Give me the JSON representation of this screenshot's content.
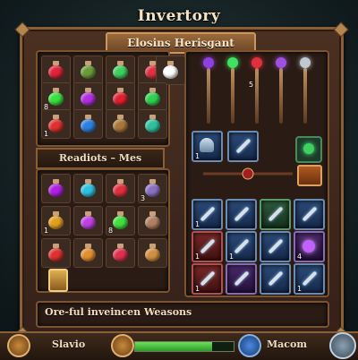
{
  "window_title": "Invertory",
  "banner_title": "Elosins Herisgant",
  "left_section_title": "Readiots – Mes storving",
  "footer_text": "Ore-ful inveincen Weasons",
  "bottom_bar": {
    "left_label": "Slavio",
    "right_label": "Macom",
    "progress": 0.78
  },
  "colors": {
    "accent": "#8a5e36",
    "panel": "#2a1c14",
    "text": "#f0dcc0"
  },
  "potions_top": [
    {
      "color": "#e0233a",
      "qty": ""
    },
    {
      "color": "#6b9a3a",
      "qty": ""
    },
    {
      "color": "#3ed060",
      "qty": ""
    },
    {
      "color": "#e03040",
      "qty": ""
    },
    {
      "color": "#ffffff",
      "qty": ""
    },
    {
      "color": "#39e040",
      "qty": "8"
    },
    {
      "color": "#b030e0",
      "qty": ""
    },
    {
      "color": "#e02030",
      "qty": ""
    },
    {
      "color": "#30d050",
      "qty": ""
    },
    {
      "color": "#e03030",
      "qty": "1"
    },
    {
      "color": "#2e80e0",
      "qty": ""
    },
    {
      "color": "#a8783a",
      "qty": ""
    },
    {
      "color": "#30c0a0",
      "qty": ""
    }
  ],
  "potions_mid": [
    {
      "color": "#b020e0",
      "qty": ""
    },
    {
      "color": "#30c0e0",
      "qty": ""
    },
    {
      "color": "#e03040",
      "qty": ""
    },
    {
      "color": "#8a70c0",
      "qty": "3"
    },
    {
      "color": "#e0a020",
      "qty": "1"
    },
    {
      "color": "#c040e0",
      "qty": ""
    },
    {
      "color": "#40e040",
      "qty": "8"
    },
    {
      "color": "#b08060",
      "qty": ""
    },
    {
      "color": "#e03030",
      "qty": ""
    },
    {
      "color": "#e09030",
      "qty": ""
    },
    {
      "color": "#e03050",
      "qty": ""
    },
    {
      "color": "#d09040",
      "qty": ""
    }
  ],
  "staff_items": [
    {
      "name": "purple-staff",
      "color": "#9040e0",
      "qty": ""
    },
    {
      "name": "green-staff",
      "color": "#40e060",
      "qty": ""
    },
    {
      "name": "red-potion-flask",
      "color": "#e03040",
      "qty": "5"
    },
    {
      "name": "purple-orb",
      "color": "#a050e0",
      "qty": ""
    },
    {
      "name": "trident",
      "color": "#c0c8d0",
      "qty": ""
    }
  ],
  "gear_grid": [
    {
      "variant": "blue",
      "icon": "sword",
      "qty": "1"
    },
    {
      "variant": "blue",
      "icon": "sword",
      "qty": ""
    },
    {
      "variant": "green",
      "icon": "sword",
      "qty": ""
    },
    {
      "variant": "blue",
      "icon": "sword",
      "qty": ""
    },
    {
      "variant": "red",
      "icon": "sword",
      "qty": "1"
    },
    {
      "variant": "blue",
      "icon": "sword",
      "qty": "1"
    },
    {
      "variant": "blue",
      "icon": "sword",
      "qty": ""
    },
    {
      "variant": "purple",
      "icon": "orb",
      "qty": "4"
    },
    {
      "variant": "red",
      "icon": "sword",
      "qty": "1"
    },
    {
      "variant": "purple",
      "icon": "sword",
      "qty": ""
    },
    {
      "variant": "blue",
      "icon": "sword",
      "qty": ""
    },
    {
      "variant": "blue",
      "icon": "sword",
      "qty": "1"
    }
  ],
  "quick_slots": [
    {
      "variant": "blue",
      "icon": "helm",
      "qty": "1"
    },
    {
      "variant": "blue",
      "icon": "sword",
      "qty": ""
    }
  ]
}
